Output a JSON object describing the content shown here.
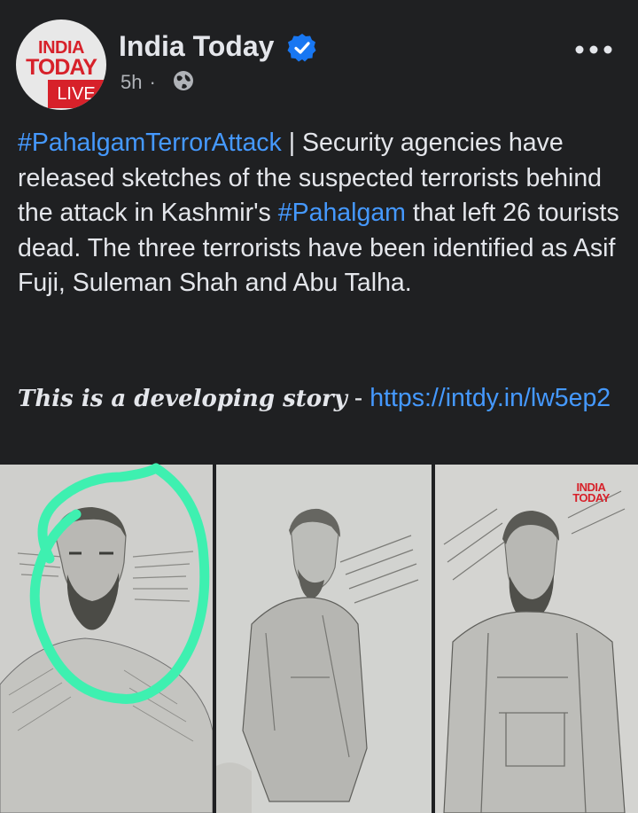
{
  "post": {
    "avatar": {
      "line1": "INDIA",
      "line2": "TODAY",
      "line3": "LIVE"
    },
    "page_name": "India Today",
    "time": "5h",
    "separator": "·",
    "text": {
      "hashtag1": "#PahalgamTerrorAttack",
      "part1": " | Security agencies have released sketches of the suspected terrorists behind the attack in Kashmir's ",
      "hashtag2": "#Pahalgam",
      "part2": " that left 26 tourists dead. The three terrorists have been identified as Asif Fuji, Suleman Shah and Abu Talha."
    },
    "developing": {
      "emphasis": "This is a developing story",
      "dash": " - ",
      "link": "https://intdy.in/lw5ep2"
    },
    "watermark": {
      "line1": "INDIA",
      "line2": "TODAY"
    }
  },
  "colors": {
    "background": "#1f2022",
    "text": "#e4e6eb",
    "muted": "#b0b3b8",
    "link": "#4599ff",
    "brand_red": "#d7212a",
    "verified_blue": "#1877f2",
    "highlight_circle": "#3ef0b0"
  },
  "icons": [
    "verified-badge-icon",
    "globe-icon",
    "more-options-icon"
  ]
}
